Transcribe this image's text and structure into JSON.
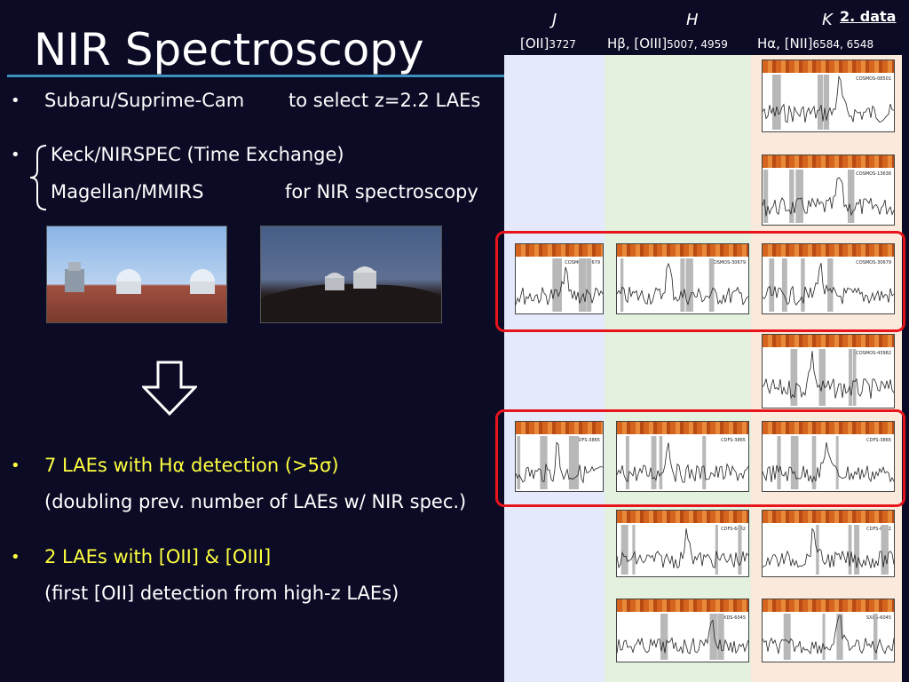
{
  "slide": {
    "title": "NIR Spectroscopy",
    "section_tag": "2. data"
  },
  "bullets": {
    "b1": {
      "text": "Subaru/Suprime-Cam",
      "suffix": "to select z=2.2 LAEs"
    },
    "b2": {
      "line1": "Keck/NIRSPEC (Time Exchange)",
      "line2": "Magellan/MMIRS",
      "suffix": "for NIR spectroscopy"
    },
    "b3": {
      "main": "7 LAEs with Hα detection (>5σ)",
      "sub": "(doubling prev. number of LAEs w/ NIR spec.)"
    },
    "b4": {
      "main": "2 LAEs with [OII] & [OIII]",
      "sub": "(first [OII] detection from high-z LAEs)"
    }
  },
  "bands": {
    "J": {
      "band": "J",
      "line": "[OII]",
      "wl": "3727"
    },
    "H": {
      "band": "H",
      "line": "Hβ, [OIII]",
      "wl": "5007, 4959"
    },
    "K": {
      "band": "K",
      "line": "Hα, [NII]",
      "wl": "6584, 6548"
    }
  },
  "spectra_labels": [
    "COSMOS-08501",
    "COSMOS-13636",
    "COSMOS-30679",
    "COSMOS-43982",
    "CDFS-3865",
    "CDFS-6482",
    "SXDS-6045"
  ],
  "colors": {
    "background": "#0b0b26",
    "title_rule": "#3d8fbd",
    "highlight_text": "#ffff40",
    "highlight_box": "#e8141c",
    "col_J": "#e4e9fb",
    "col_H": "#e3f1de",
    "col_K": "#fbeadc"
  },
  "icons": [
    "down-arrow-icon",
    "left-brace-icon"
  ]
}
